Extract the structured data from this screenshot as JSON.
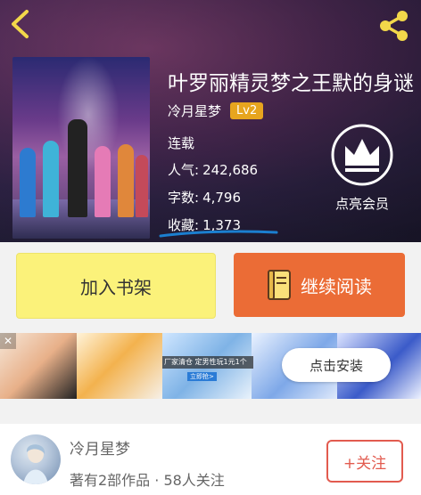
{
  "book": {
    "title": "叶罗丽精灵梦之王默的身谜",
    "author": "冷月星梦",
    "level": "Lv2",
    "status": "连载",
    "popularity_label": "人气:",
    "popularity_value": "242,686",
    "wordcount_label": "字数:",
    "wordcount_value": "4,796",
    "favorites_label": "收藏:",
    "favorites_value": "1,373"
  },
  "vip": {
    "label": "点亮会员"
  },
  "actions": {
    "add_shelf": "加入书架",
    "continue_read": "继续阅读"
  },
  "ad": {
    "caption": "厂家清仓 定男性玩1元1个",
    "sub": "立即抢>",
    "install": "点击安装",
    "close": "✕"
  },
  "author_card": {
    "name": "冷月星梦",
    "stats": "著有2部作品 · 58人关注",
    "follow": "+关注"
  },
  "colors": {
    "accent_orange": "#eb6c36",
    "shelf_yellow": "#fbf27a",
    "level_badge": "#e7a51e",
    "follow_red": "#e25b4f",
    "header_back_icon": "#f2d84a",
    "underline_blue": "#1b7fd0"
  },
  "icons": [
    "back-arrow-icon",
    "share-icon",
    "crown-icon",
    "book-icon"
  ]
}
